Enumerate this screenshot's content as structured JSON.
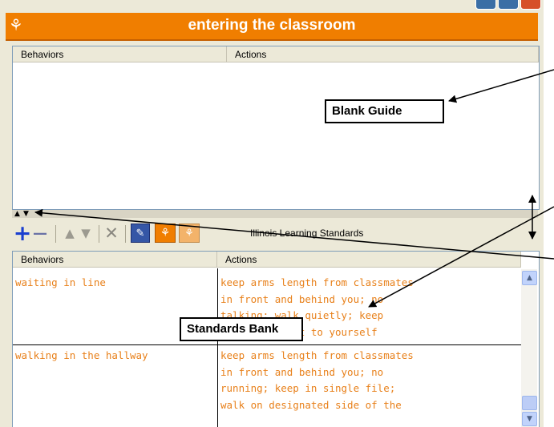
{
  "window": {
    "title": "entering the classroom"
  },
  "top_panel": {
    "columns": [
      "Behaviors",
      "Actions"
    ]
  },
  "toolbar": {
    "add_icon": "+",
    "remove_icon": "—",
    "up_icon": "▲",
    "down_icon": "▼",
    "delete_icon": "✕",
    "label": "Illinois Learning Standards"
  },
  "bottom_panel": {
    "columns": [
      "Behaviors",
      "Actions"
    ],
    "rows": [
      {
        "behavior": "waiting in line",
        "action_lines": [
          "keep arms length from classmates",
          "in front and behind you; no",
          "talking; walk quietly; keep",
          "hands and feet to yourself"
        ]
      },
      {
        "behavior": "walking in the hallway",
        "action_lines": [
          "keep arms length from classmates",
          "in front and behind you; no",
          "running; keep in single file;",
          "walk on designated side of the"
        ]
      }
    ]
  },
  "annotations": {
    "blank_guide": "Blank Guide",
    "standards_bank": "Standards Bank"
  },
  "colors": {
    "title_bar": "#F07E00",
    "cell_text": "#E8801A",
    "window_bg": "#ECE9D8"
  }
}
